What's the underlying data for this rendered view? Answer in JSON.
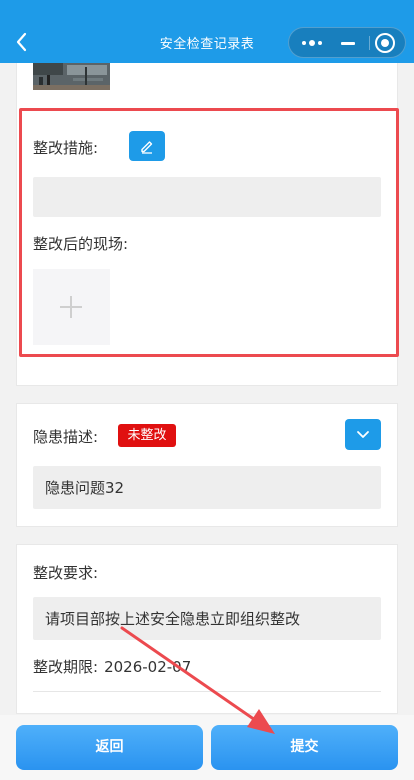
{
  "header": {
    "title": "安全检查记录表",
    "back_icon": "chevron-left-icon",
    "capsule_icons": [
      "more-dots-icon",
      "minimize-icon",
      "close-circle-icon"
    ],
    "background_color": "#1e9be8"
  },
  "rectification": {
    "measures_label": "整改措施:",
    "measures_value": "",
    "edit_icon": "pencil-icon",
    "after_photo_label": "整改后的现场:",
    "upload_icon": "plus-icon",
    "highlight_color": "#ec4a4f"
  },
  "hazard": {
    "label": "隐患描述:",
    "status_badge": "未整改",
    "status_color": "#e01010",
    "description": "隐患问题32",
    "expand_icon": "chevron-down-icon"
  },
  "requirement": {
    "label": "整改要求:",
    "text": "请项目部按上述安全隐患立即组织整改",
    "deadline_label": "整改期限:",
    "deadline_value": "2026-02-07"
  },
  "footer": {
    "back_label": "返回",
    "submit_label": "提交",
    "button_color": "#2a93f0"
  },
  "annotation": {
    "arrow_color": "#ec4a4f"
  }
}
